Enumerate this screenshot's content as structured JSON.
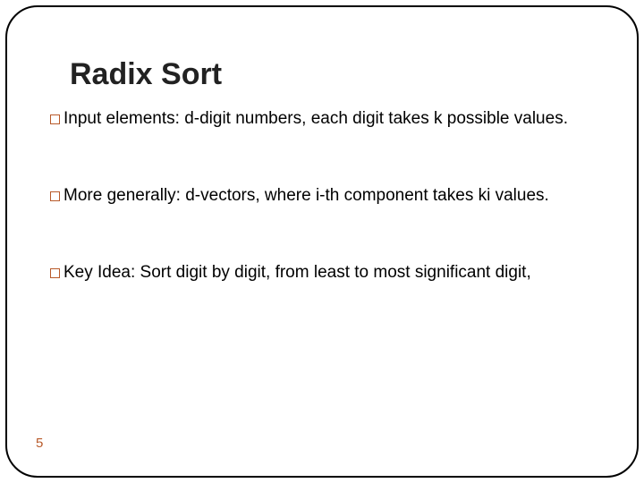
{
  "title": "Radix Sort",
  "bullets": [
    "Input elements: d-digit numbers, each digit takes k possible values.",
    "More generally: d-vectors, where i-th component takes ki values.",
    "Key Idea: Sort digit by digit, from least to most significant digit,"
  ],
  "page_number": "5"
}
